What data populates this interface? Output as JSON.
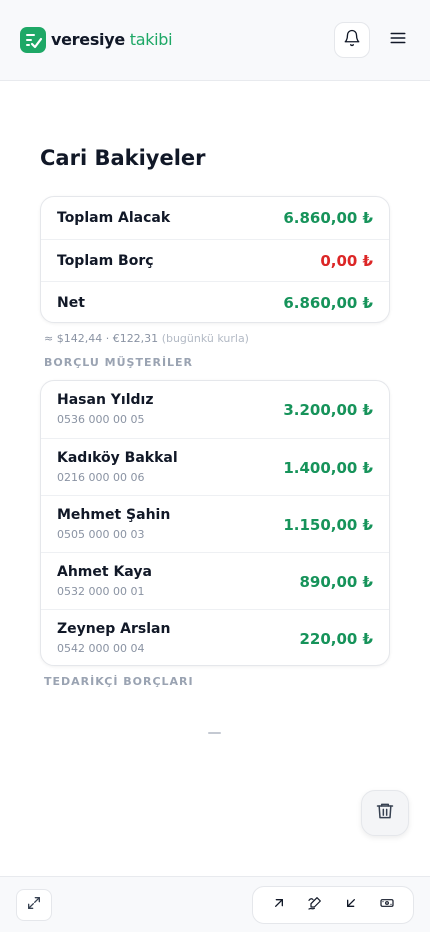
{
  "header": {
    "brand_primary": "veresiye",
    "brand_secondary": "takibi",
    "logo_icon": "checklist-icon",
    "accent_color": "#1ea866"
  },
  "main": {
    "title": "Cari Bakiyeler",
    "summary": [
      {
        "label": "Toplam Alacak",
        "value": "6.860,00 ₺",
        "status": "positive"
      },
      {
        "label": "Toplam Borç",
        "value": "0,00 ₺",
        "status": "negative"
      },
      {
        "label": "Net",
        "value": "6.860,00 ₺",
        "status": "positive"
      }
    ],
    "fx_rates": "≈ $142,44 · €122,31",
    "fx_note": "(bugünkü kurla)",
    "debtors_heading": "BORÇLU MÜŞTERİLER",
    "debtors": [
      {
        "name": "Hasan Yıldız",
        "phone": "0536 000 00 05",
        "amount": "3.200,00 ₺"
      },
      {
        "name": "Kadıköy Bakkal",
        "phone": "0216 000 00 06",
        "amount": "1.400,00 ₺"
      },
      {
        "name": "Mehmet Şahin",
        "phone": "0505 000 00 03",
        "amount": "1.150,00 ₺"
      },
      {
        "name": "Ahmet Kaya",
        "phone": "0532 000 00 01",
        "amount": "890,00 ₺"
      },
      {
        "name": "Zeynep Arslan",
        "phone": "0542 000 00 04",
        "amount": "220,00 ₺"
      }
    ],
    "suppliers_heading": "TEDARİKÇİ BORÇLARI",
    "suppliers_placeholder": "—"
  },
  "colors": {
    "positive": "#16935a",
    "negative": "#dc2626"
  },
  "icons": {
    "notifications": "bell-icon",
    "menu": "hamburger-menu-icon",
    "delete": "trash-icon",
    "expand": "expand-icon",
    "tools": [
      "arrow-up-right-icon",
      "sign-pen-icon",
      "arrow-down-left-icon",
      "cash-icon"
    ]
  }
}
